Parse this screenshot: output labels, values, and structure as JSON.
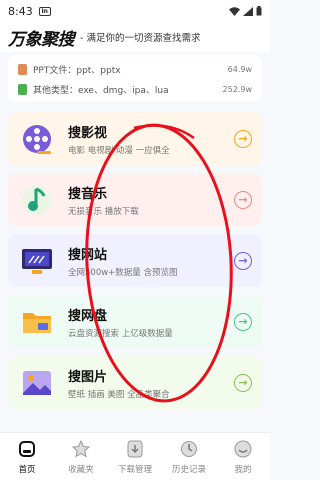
{
  "status": {
    "time": "8:43",
    "notif_badge": "In"
  },
  "header": {
    "brand": "万象聚搜",
    "tagline": "- 满足你的一切资源查找需求"
  },
  "file_types": [
    {
      "label": "PPT文件：ppt、pptx",
      "count": "64.9w",
      "color": "#e28a56"
    },
    {
      "label": "其他类型：exe、dmg、ipa、lua",
      "count": "252.9w",
      "color": "#4caf50"
    }
  ],
  "cards": [
    {
      "title": "搜影视",
      "desc": "电影 电视剧 动漫 一应俱全",
      "bg": "#fff6e9",
      "accent": "#f5a623"
    },
    {
      "title": "搜音乐",
      "desc": "无损音乐 播放下载",
      "bg": "#fff0ef",
      "accent": "#f08a84"
    },
    {
      "title": "搜网站",
      "desc": "全网500w+数据量 含预览图",
      "bg": "#f1f0ff",
      "accent": "#6c63e0"
    },
    {
      "title": "搜网盘",
      "desc": "云盘资源搜索 上亿级数据量",
      "bg": "#eefbf4",
      "accent": "#4cc38a"
    },
    {
      "title": "搜图片",
      "desc": "壁纸 插画 美图 全品类聚合",
      "bg": "#f3fbec",
      "accent": "#8cc152"
    }
  ],
  "tabs": [
    {
      "label": "首页",
      "icon": "home-icon",
      "active": true
    },
    {
      "label": "收藏夹",
      "icon": "star-icon",
      "active": false
    },
    {
      "label": "下载管理",
      "icon": "download-icon",
      "active": false
    },
    {
      "label": "历史记录",
      "icon": "history-icon",
      "active": false
    },
    {
      "label": "我的",
      "icon": "profile-icon",
      "active": false
    }
  ],
  "annotation_color": "#e8101a"
}
